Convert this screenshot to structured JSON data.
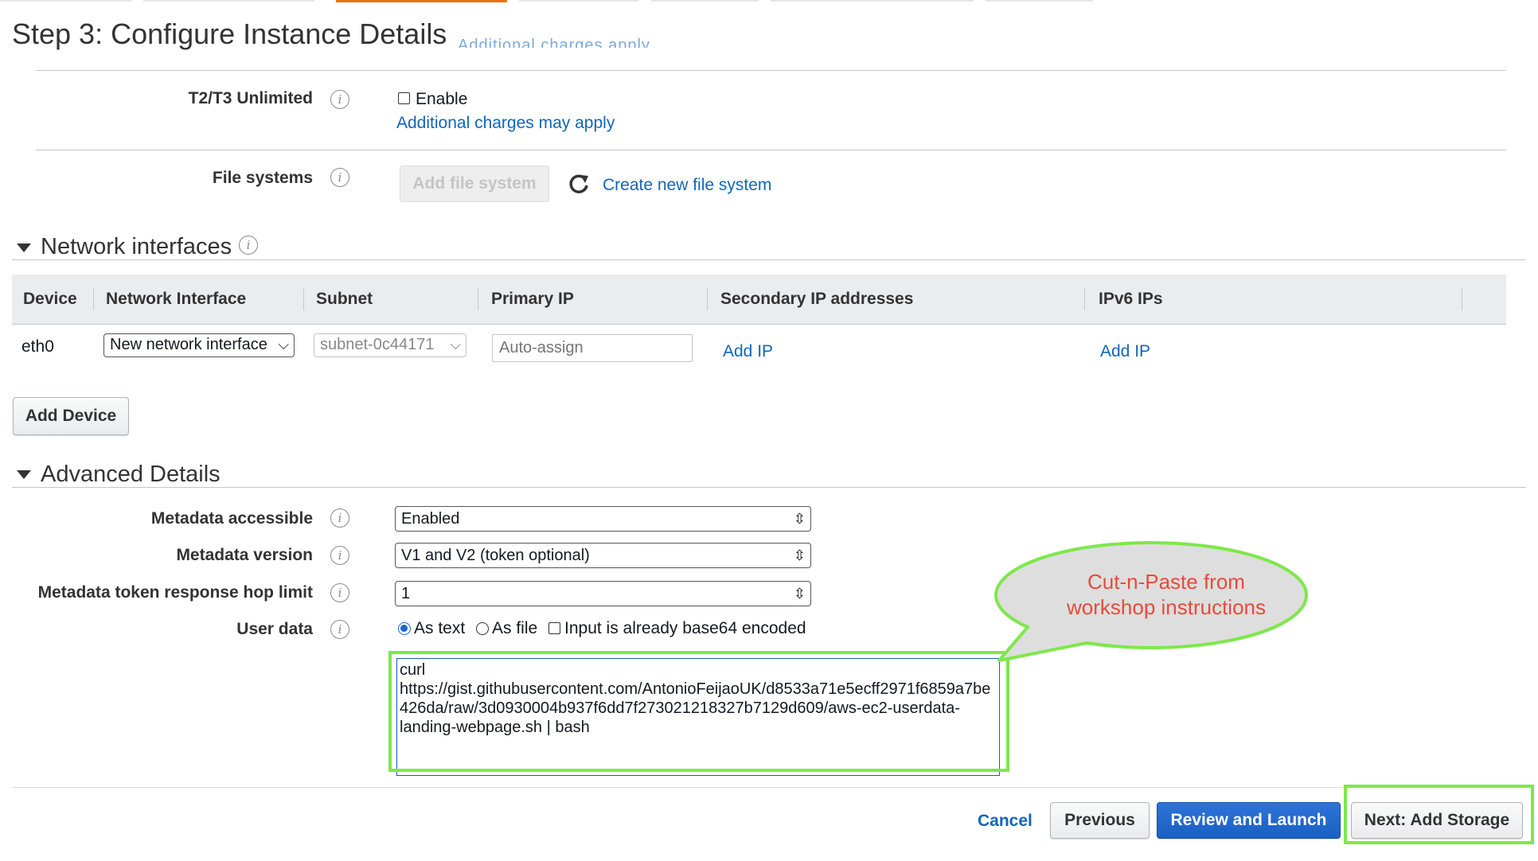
{
  "page": {
    "title": "Step 3: Configure Instance Details"
  },
  "header_fragment": "Additional charges apply",
  "t2t3": {
    "label": "T2/T3 Unlimited",
    "checkbox_label": "Enable",
    "link": "Additional charges may apply"
  },
  "file_systems": {
    "label": "File systems",
    "add_button": "Add file system",
    "create_link": "Create new file system"
  },
  "network_interfaces": {
    "title": "Network interfaces",
    "columns": [
      "Device",
      "Network Interface",
      "Subnet",
      "Primary IP",
      "Secondary IP addresses",
      "IPv6 IPs"
    ],
    "rows": [
      {
        "device": "eth0",
        "interface": "New network interface",
        "subnet": "subnet-0c44171",
        "primary_ip_placeholder": "Auto-assign",
        "secondary_ip_link": "Add IP",
        "ipv6_link": "Add IP"
      }
    ],
    "add_device_button": "Add Device"
  },
  "advanced_details": {
    "title": "Advanced Details",
    "metadata_accessible": {
      "label": "Metadata accessible",
      "value": "Enabled"
    },
    "metadata_version": {
      "label": "Metadata version",
      "value": "V1 and V2 (token optional)"
    },
    "hop_limit": {
      "label": "Metadata token response hop limit",
      "value": "1"
    },
    "user_data": {
      "label": "User data",
      "options": [
        "As text",
        "As file"
      ],
      "selected": "As text",
      "base64_label": "Input is already base64 encoded",
      "value": "curl\nhttps://gist.githubusercontent.com/AntonioFeijaoUK/d8533a71e5ecff2971f6859a7be426da/raw/3d0930004b937f6dd7f273021218327b7129d609/aws-ec2-userdata-landing-webpage.sh | bash"
    }
  },
  "callout": {
    "line1": "Cut-n-Paste from",
    "line2": "workshop instructions"
  },
  "footer": {
    "cancel": "Cancel",
    "previous": "Previous",
    "review_launch": "Review and Launch",
    "next": "Next: Add Storage"
  },
  "colors": {
    "link": "#1166bb",
    "primary": "#1a5fc4",
    "highlight": "#7de84a",
    "callout_text": "#e84a3a",
    "tab_active": "#ec7211"
  }
}
